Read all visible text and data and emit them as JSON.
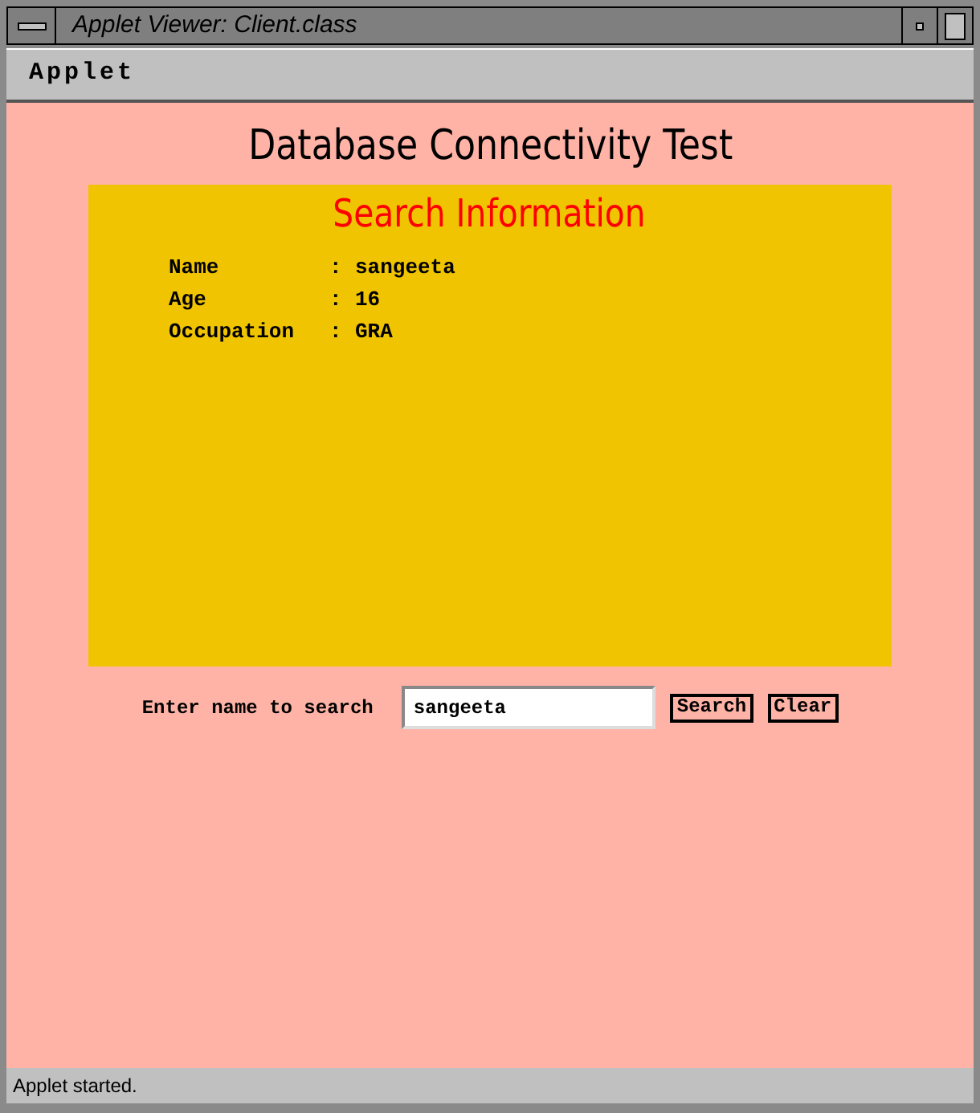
{
  "window": {
    "title": "Applet Viewer: Client.class"
  },
  "menu_bar": {
    "items": [
      "Applet"
    ]
  },
  "applet": {
    "heading": "Database Connectivity Test",
    "panel_title": "Search Information",
    "fields": [
      {
        "label": "Name",
        "separator": ":",
        "value": "sangeeta"
      },
      {
        "label": "Age",
        "separator": ":",
        "value": "16"
      },
      {
        "label": "Occupation",
        "separator": ":",
        "value": "GRA"
      }
    ],
    "search_label": "Enter name to search",
    "search_value": "sangeeta",
    "buttons": [
      "Search",
      "Clear"
    ]
  },
  "status_bar": "Applet started."
}
